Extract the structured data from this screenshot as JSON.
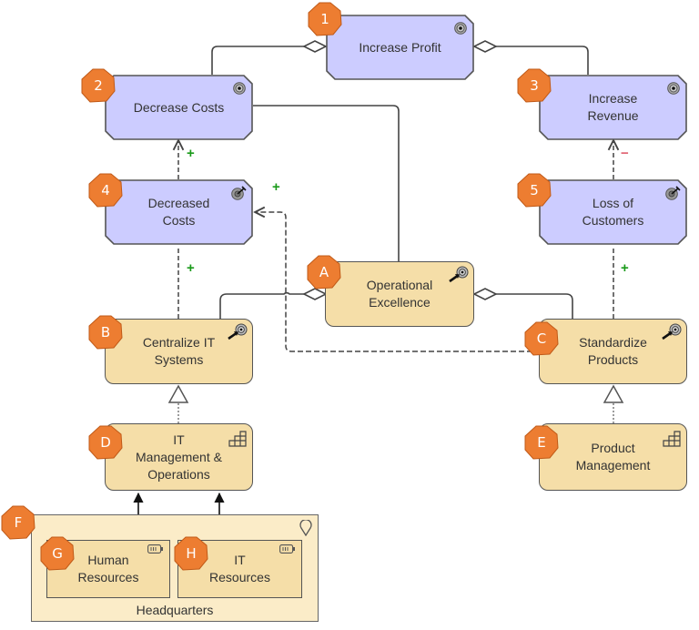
{
  "diagram": {
    "title": "",
    "colors": {
      "goal_fill": "#ccccff",
      "outcome_fill": "#ccccff",
      "strategy_fill": "#f5dea8",
      "location_fill": "#fbecc8",
      "badge_fill": "#ed7d31",
      "positive": "#1a9a1a",
      "negative": "#e06070"
    },
    "goals": [
      {
        "id": "1",
        "label": "Increase Profit",
        "type": "goal"
      },
      {
        "id": "2",
        "label": "Decrease Costs",
        "type": "goal"
      },
      {
        "id": "3",
        "label": "Increase\nRevenue",
        "type": "goal"
      }
    ],
    "outcomes": [
      {
        "id": "4",
        "label": "Decreased\nCosts",
        "type": "outcome"
      },
      {
        "id": "5",
        "label": "Loss of\nCustomers",
        "type": "outcome"
      }
    ],
    "courses_of_action": [
      {
        "id": "A",
        "label": "Operational\nExcellence",
        "type": "course-of-action"
      },
      {
        "id": "B",
        "label": "Centralize IT\nSystems",
        "type": "course-of-action"
      },
      {
        "id": "C",
        "label": "Standardize\nProducts",
        "type": "course-of-action"
      }
    ],
    "capabilities": [
      {
        "id": "D",
        "label": "IT\nManagement &\nOperations",
        "type": "capability"
      },
      {
        "id": "E",
        "label": "Product\nManagement",
        "type": "capability"
      }
    ],
    "location": {
      "id": "F",
      "label": "Headquarters",
      "type": "location"
    },
    "resources": [
      {
        "id": "G",
        "label": "Human\nResources",
        "type": "resource"
      },
      {
        "id": "H",
        "label": "IT\nResources",
        "type": "resource"
      }
    ],
    "influence_signs": {
      "4_to_2": "+",
      "B_to_4": "+",
      "C_to_4": "+",
      "5_to_3": "−",
      "C_to_5": "+"
    },
    "relationships": [
      {
        "from": "2",
        "to": "1",
        "type": "aggregation"
      },
      {
        "from": "3",
        "to": "1",
        "type": "aggregation"
      },
      {
        "from": "A",
        "to": "2",
        "type": "association"
      },
      {
        "from": "4",
        "to": "2",
        "type": "influence",
        "sign": "+"
      },
      {
        "from": "5",
        "to": "3",
        "type": "influence",
        "sign": "−"
      },
      {
        "from": "B",
        "to": "4",
        "type": "influence",
        "sign": "+"
      },
      {
        "from": "C",
        "to": "4",
        "type": "influence",
        "sign": "+"
      },
      {
        "from": "C",
        "to": "5",
        "type": "influence",
        "sign": "+"
      },
      {
        "from": "B",
        "to": "A",
        "type": "aggregation"
      },
      {
        "from": "C",
        "to": "A",
        "type": "aggregation"
      },
      {
        "from": "D",
        "to": "B",
        "type": "realization"
      },
      {
        "from": "E",
        "to": "C",
        "type": "realization"
      },
      {
        "from": "G",
        "to": "D",
        "type": "assignment"
      },
      {
        "from": "H",
        "to": "D",
        "type": "assignment"
      }
    ]
  }
}
